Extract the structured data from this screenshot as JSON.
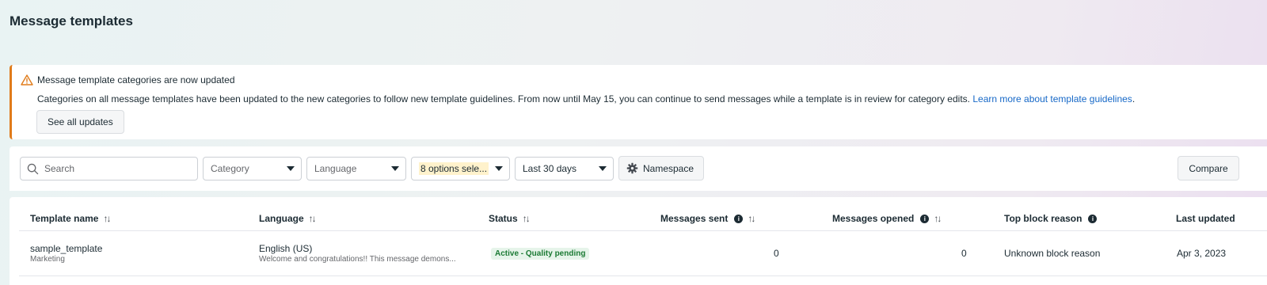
{
  "page": {
    "title": "Message templates"
  },
  "alert": {
    "title": "Message template categories are now updated",
    "body": "Categories on all message templates have been updated to the new categories to follow new template guidelines. From now until May 15, you can continue to send messages while a template is in review for category edits.",
    "link_text": "Learn more about template guidelines",
    "body_end": ".",
    "button_label": "See all updates",
    "accent_color": "#e07b1a"
  },
  "filters": {
    "search_placeholder": "Search",
    "category_label": "Category",
    "language_label": "Language",
    "status_label": "8 options sele...",
    "date_label": "Last 30 days",
    "namespace_label": "Namespace",
    "compare_label": "Compare"
  },
  "table": {
    "columns": [
      {
        "label": "Template name",
        "sortable": true,
        "info": false
      },
      {
        "label": "Language",
        "sortable": true,
        "info": false
      },
      {
        "label": "Status",
        "sortable": true,
        "info": false
      },
      {
        "label": "Messages sent",
        "sortable": true,
        "info": true
      },
      {
        "label": "Messages opened",
        "sortable": true,
        "info": true
      },
      {
        "label": "Top block reason",
        "sortable": false,
        "info": true
      },
      {
        "label": "Last updated",
        "sortable": false,
        "info": false
      }
    ],
    "sort_glyph": "↑↓",
    "info_glyph": "i",
    "rows": [
      {
        "name": "sample_template",
        "category": "Marketing",
        "language": "English (US)",
        "preview": "Welcome and congratulations!! This message demons...",
        "status": "Active - Quality pending",
        "messages_sent": "0",
        "messages_opened": "0",
        "block_reason": "Unknown block reason",
        "last_updated": "Apr 3, 2023"
      }
    ]
  },
  "colors": {
    "link": "#1668c7",
    "status_active_bg": "#e6f4ea",
    "status_active_text": "#1b7a34"
  },
  "icons": [
    "warning-icon",
    "search-icon",
    "gear-icon",
    "caret-down-icon",
    "sort-icon",
    "info-icon"
  ]
}
